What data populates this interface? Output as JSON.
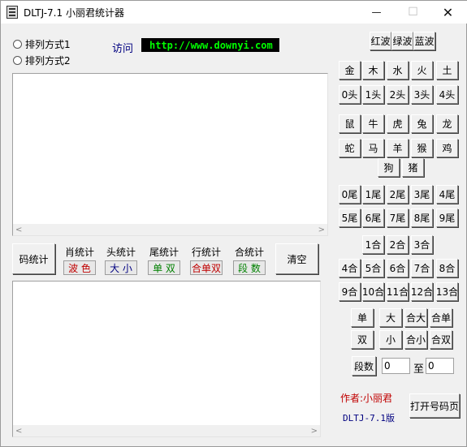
{
  "window": {
    "title": "DLTJ-7.1 小丽君统计器",
    "minimize": "—",
    "maximize": "☐",
    "close": "✕"
  },
  "radios": [
    "排列方式1",
    "排列方式2"
  ],
  "visit_label": "访问",
  "url": "http://www.downyi.com",
  "wave_buttons": [
    "红波",
    "绿波",
    "蓝波"
  ],
  "elements": [
    "金",
    "木",
    "水",
    "火",
    "土"
  ],
  "heads": [
    "0头",
    "1头",
    "2头",
    "3头",
    "4头"
  ],
  "zodiac_row1": [
    "鼠",
    "牛",
    "虎",
    "兔",
    "龙"
  ],
  "zodiac_row2": [
    "蛇",
    "马",
    "羊",
    "猴",
    "鸡"
  ],
  "zodiac_row3": [
    "狗",
    "猪"
  ],
  "tails_row1": [
    "0尾",
    "1尾",
    "2尾",
    "3尾",
    "4尾"
  ],
  "tails_row2": [
    "5尾",
    "6尾",
    "7尾",
    "8尾",
    "9尾"
  ],
  "sums_row1": [
    "1合",
    "2合",
    "3合"
  ],
  "sums_row2": [
    "4合",
    "5合",
    "6合",
    "7合",
    "8合"
  ],
  "sums_row3": [
    "9合",
    "10合",
    "11合",
    "12合",
    "13合"
  ],
  "oe_row1": [
    "单",
    "大",
    "合大",
    "合单"
  ],
  "oe_row2": [
    "双",
    "小",
    "合小",
    "合双"
  ],
  "segment": {
    "label": "段数",
    "from": "0",
    "to_label": "至",
    "to": "0"
  },
  "author": "作者:小丽君",
  "version": "DLTJ-7.1版",
  "open_button": "打开号码页",
  "code_stat": "码统计",
  "clear": "清空",
  "stats": [
    {
      "top": "肖统计",
      "sub": "波 色",
      "color": "#c00000"
    },
    {
      "top": "头统计",
      "sub": "大 小",
      "color": "#000080"
    },
    {
      "top": "尾统计",
      "sub": "单 双",
      "color": "#008000"
    },
    {
      "top": "行统计",
      "sub": "合单双",
      "color": "#c00000"
    },
    {
      "top": "合统计",
      "sub": "段 数",
      "color": "#008000"
    }
  ],
  "colors": {
    "author": "#c00000",
    "version": "#000080",
    "visit": "#000080",
    "url_bg": "#000000",
    "url_fg": "#00ff00"
  },
  "scroll_arrows": {
    "left": "<",
    "right": ">"
  }
}
